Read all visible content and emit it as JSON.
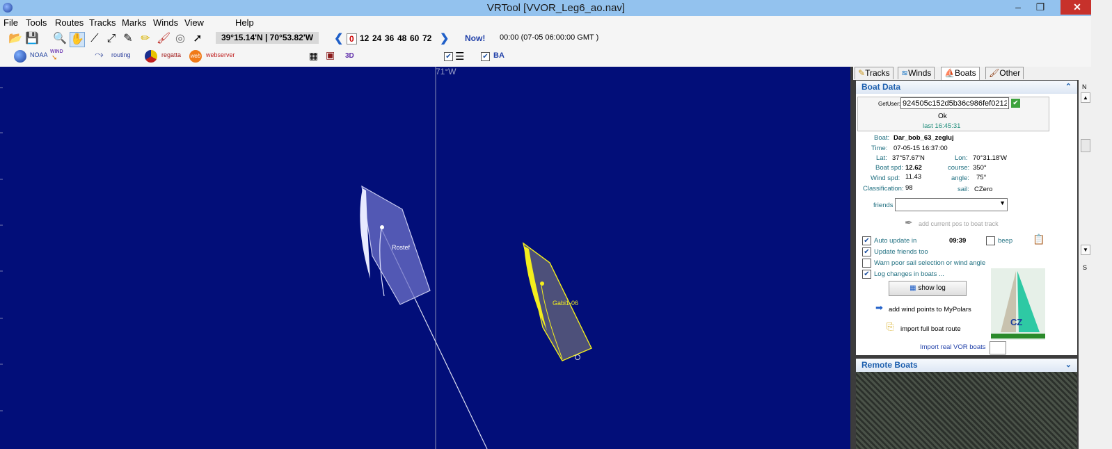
{
  "window": {
    "title": "VRTool [VVOR_Leg6_ao.nav]",
    "min": "–",
    "max": "❐",
    "close": "✕"
  },
  "menu": [
    "File",
    "Tools",
    "Routes",
    "Tracks",
    "Marks",
    "Winds",
    "View",
    "Help"
  ],
  "toolbar": {
    "coords": "39°15.14'N | 70°53.82'W",
    "hours": [
      "0",
      "12",
      "24",
      "36",
      "48",
      "60",
      "72"
    ],
    "now_label": "Now!",
    "time_text": "00:00 (07-05 06:00:00 GMT )"
  },
  "toolbar2": {
    "noaa": "NOAA",
    "wind_logo": "WIND",
    "routing": "routing",
    "regatta": "regatta",
    "web_logo": "web",
    "webserver": "webserver",
    "label_3d": "3D",
    "ba_label": "BA"
  },
  "map": {
    "meridian_label": "71°W"
  },
  "boats": [
    {
      "name": "Rostef",
      "color": "#e3e6ff"
    },
    {
      "name": "Gabi1-06",
      "color": "#f3ee1d"
    }
  ],
  "tabs": [
    {
      "label": "Tracks",
      "icon": "pen-icon"
    },
    {
      "label": "Winds",
      "icon": "wind-icon"
    },
    {
      "label": "Boats",
      "icon": "boat-icon"
    },
    {
      "label": "Other",
      "icon": "brush-icon"
    }
  ],
  "boat_data": {
    "header": "Boat Data",
    "getuser_label": "GetUser:",
    "getuser_value": "924505c152d5b36c986fef0212",
    "status": "Ok",
    "last": "last 16:45:31",
    "fields": {
      "boat_label": "Boat:",
      "boat": "Dar_bob_63_zegluj",
      "time_label": "Time:",
      "time": "07-05-15 16:37:00",
      "lat_label": "Lat:",
      "lat": "37°57.67'N",
      "lon_label": "Lon:",
      "lon": "70°31.18'W",
      "boatspd_label": "Boat spd:",
      "boatspd": "12.62",
      "course_label": "course:",
      "course": "350°",
      "windspd_label": "Wind  spd:",
      "windspd": "11.43",
      "angle_label": "angle:",
      "angle": "75°",
      "class_label": "Classification:",
      "class": "98",
      "sail_label": "sail:",
      "sail": "CZero"
    },
    "friends_label": "friends",
    "add_current_pos": "add current pos to boat track",
    "auto_update": "Auto update in",
    "countdown": "09:39",
    "beep": "beep",
    "update_friends": "Update friends too",
    "warn_poor": "Warn poor sail selection or wind angle",
    "log_changes": "Log changes in boats ...",
    "show_log": "show log",
    "add_wind": "add wind points to MyPolars",
    "import_route": "import full boat route",
    "import_vor": "Import real VOR boats",
    "sail_badge": "CZ"
  },
  "remote_boats": {
    "header": "Remote Boats"
  },
  "scroll": {
    "n": "N",
    "s": "S"
  },
  "colors": {
    "map_bg": "#020e79",
    "title_bar": "#93c2ee",
    "accent": "#1d5fae"
  }
}
